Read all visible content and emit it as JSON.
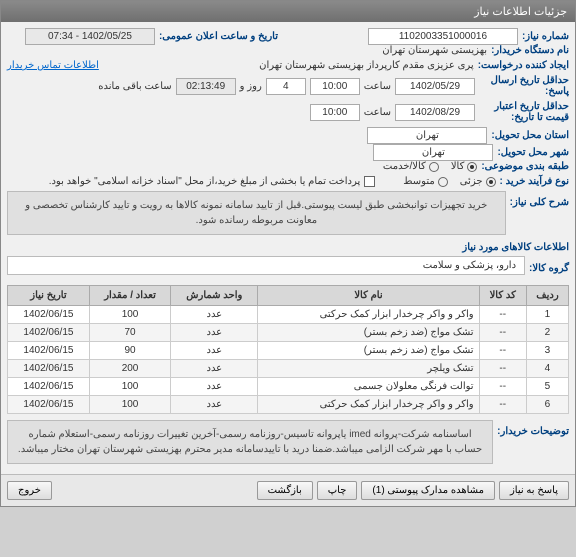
{
  "titlebar": "جزئیات اطلاعات نیاز",
  "fields": {
    "need_number_label": "شماره نیاز:",
    "need_number": "1102003351000016",
    "announce_datetime_label": "تاریخ و ساعت اعلان عمومی:",
    "announce_datetime": "1402/05/25 - 07:34",
    "buyer_org_label": "نام دستگاه خریدار:",
    "buyer_org": "بهزیستی شهرستان تهران",
    "requester_label": "ایجاد کننده درخواست:",
    "requester": "پری عزیزی مقدم کارپرداز بهزیستی شهرستان تهران",
    "contact_link": "اطلاعات تماس خریدار",
    "deadline_label": "حداقل تاریخ ارسال پاسخ:",
    "deadline_date": "1402/05/29",
    "time_label": "ساعت",
    "deadline_time": "10:00",
    "days": "4",
    "days_label": "روز و",
    "remaining_time": "02:13:49",
    "remaining_label": "ساعت باقی مانده",
    "validity_label": "حداقل تاریخ اعتبار قیمت تا تاریخ:",
    "validity_date": "1402/08/29",
    "validity_time": "10:00",
    "province_label": "استان محل تحویل:",
    "province": "تهران",
    "city_label": "شهر محل تحویل:",
    "city": "تهران",
    "topic_type_label": "طبقه بندی موضوعی:",
    "process_type_label": "نوع فرآیند خرید :",
    "proc_option1": "جزئی",
    "proc_option2": "متوسط",
    "type_option1": "کالا",
    "type_option2": "کالا/خدمت",
    "payment_note": "پرداخت تمام یا بخشی از مبلغ خرید،از محل \"اسناد خزانه اسلامی\" خواهد بود.",
    "description_title": "شرح کلی نیاز:",
    "description": "خرید تجهیزات توانبخشی طبق لیست پیوستی.قبل از تایید سامانه نمونه کالاها به رویت و تایید کارشناس تخصصی و معاونت مربوطه رسانده شود.",
    "items_title": "اطلاعات کالاهای مورد نیاز",
    "group_label": "گروه کالا:",
    "group_value": "دارو، پزشکی و سلامت",
    "buyer_notes_label": "توضیحات خریدار:",
    "buyer_notes": "اساسنامه شرکت-پروانه imed یاپروانه تاسیس-روزنامه رسمی-آخرین تغییرات روزنامه رسمی-استعلام شماره حساب با مهر شرکت الزامی میباشد.ضمنا درید با تاییدسامانه مدیر محترم بهزیستی شهرستان تهران مختار میباشد."
  },
  "table": {
    "headers": {
      "row": "ردیف",
      "code": "کد کالا",
      "name": "نام کالا",
      "unit": "واحد شمارش",
      "qty": "تعداد / مقدار",
      "date": "تاریخ نیاز"
    },
    "rows": [
      {
        "n": "1",
        "code": "--",
        "name": "واکر و واکر چرخدار ابزار کمک حرکتی",
        "unit": "عدد",
        "qty": "100",
        "date": "1402/06/15"
      },
      {
        "n": "2",
        "code": "--",
        "name": "تشک مواج (ضد زخم بستر)",
        "unit": "عدد",
        "qty": "70",
        "date": "1402/06/15"
      },
      {
        "n": "3",
        "code": "--",
        "name": "تشک مواج (ضد زخم بستر)",
        "unit": "عدد",
        "qty": "90",
        "date": "1402/06/15"
      },
      {
        "n": "4",
        "code": "--",
        "name": "تشک ویلچر",
        "unit": "عدد",
        "qty": "200",
        "date": "1402/06/15"
      },
      {
        "n": "5",
        "code": "--",
        "name": "توالت فرنگی معلولان جسمی",
        "unit": "عدد",
        "qty": "100",
        "date": "1402/06/15"
      },
      {
        "n": "6",
        "code": "--",
        "name": "واکر و واکر چرخدار ابزار کمک حرکتی",
        "unit": "عدد",
        "qty": "100",
        "date": "1402/06/15"
      }
    ]
  },
  "buttons": {
    "respond": "پاسخ به نیاز",
    "attachments": "مشاهده مدارک پیوستی (1)",
    "print": "چاپ",
    "back": "بازگشت",
    "exit": "خروج"
  }
}
